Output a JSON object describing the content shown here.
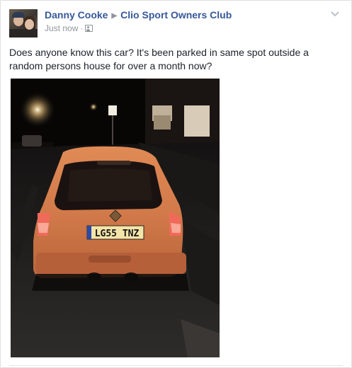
{
  "post": {
    "author": "Danny Cooke",
    "group": "Clio Sport Owners Club",
    "timestamp": "Just now",
    "separator": "·",
    "privacy_icon": "group-audience-icon",
    "menu_icon": "chevron-down-icon",
    "text": "Does anyone know this car? It's been parked in same spot outside a random persons house for over a month now?",
    "photo": {
      "plate": "LG55 TNZ"
    }
  },
  "colors": {
    "link": "#365899",
    "meta": "#90949c",
    "text": "#1d2129",
    "car_orange": "#d27a4a"
  }
}
